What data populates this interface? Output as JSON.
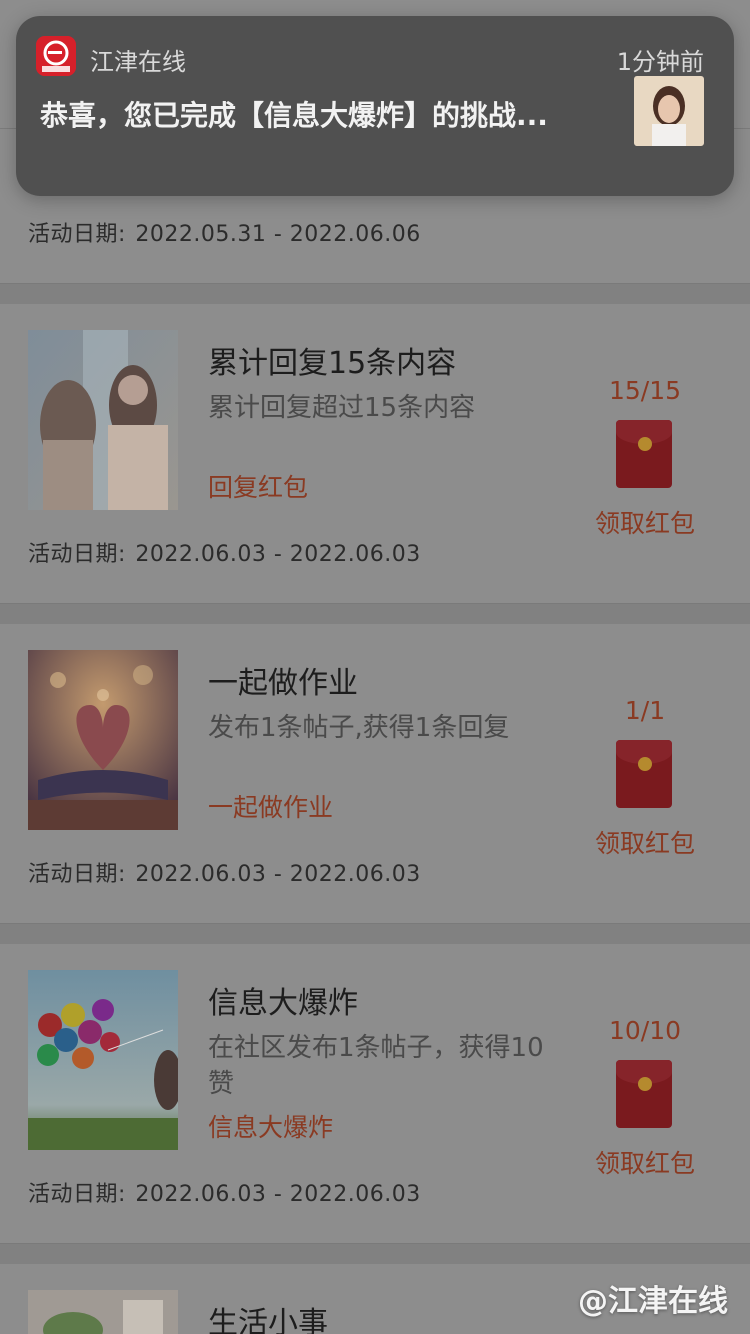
{
  "notification": {
    "app_name": "江津在线",
    "time": "1分钟前",
    "message": "恭喜，您已完成【信息大爆炸】的挑战..."
  },
  "top_card": {
    "date_label": "活动日期:",
    "date_range": "2022.05.31 - 2022.06.06"
  },
  "tasks": [
    {
      "title": "累计回复15条内容",
      "desc": "累计回复超过15条内容",
      "tag": "回复红包",
      "progress": "15/15",
      "claim": "领取红包",
      "date_label": "活动日期:",
      "date_range": "2022.06.03 - 2022.06.03"
    },
    {
      "title": "一起做作业",
      "desc": "发布1条帖子,获得1条回复",
      "tag": "一起做作业",
      "progress": "1/1",
      "claim": "领取红包",
      "date_label": "活动日期:",
      "date_range": "2022.06.03 - 2022.06.03"
    },
    {
      "title": "信息大爆炸",
      "desc": "在社区发布1条帖子，获得10赞",
      "tag": "信息大爆炸",
      "progress": "10/10",
      "claim": "领取红包",
      "date_label": "活动日期:",
      "date_range": "2022.06.03 - 2022.06.03"
    },
    {
      "title": "生活小事"
    }
  ],
  "watermark": "@江津在线",
  "colors": {
    "accent": "#8a3a22",
    "envelope": "#7a1a1e",
    "overlay": "#8d8d8d"
  }
}
